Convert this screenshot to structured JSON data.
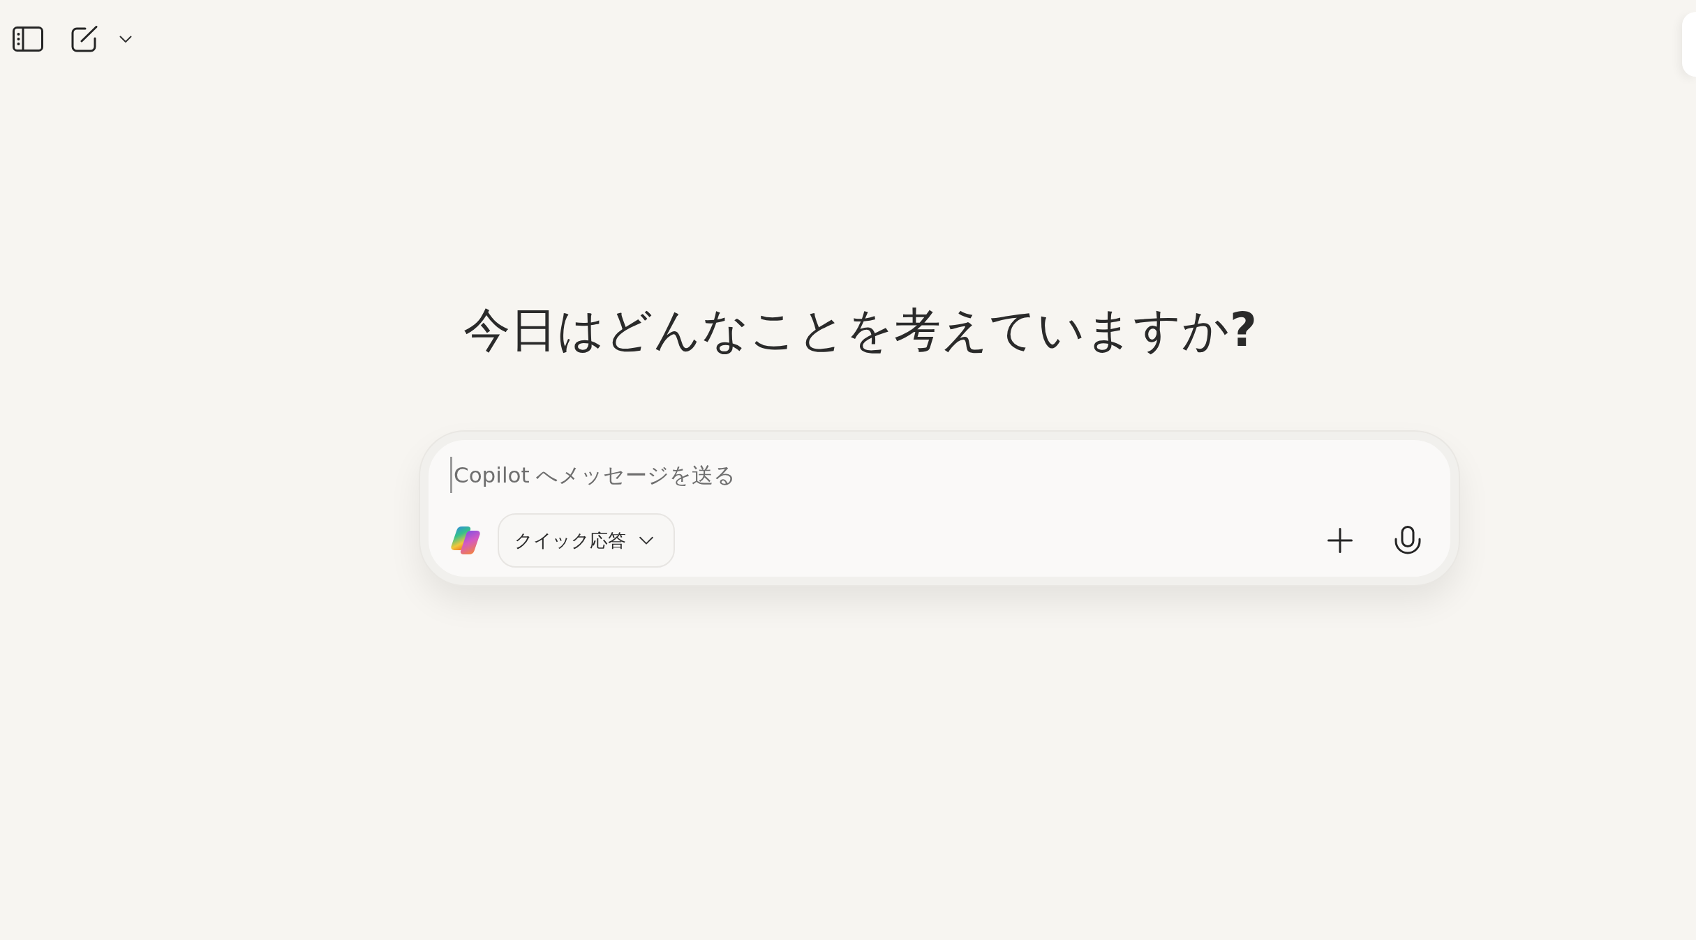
{
  "heading": "今日はどんなことを考えていますか**?**",
  "composer": {
    "placeholder": "Copilot へメッセージを送る",
    "mode_button": "クイック応答"
  }
}
